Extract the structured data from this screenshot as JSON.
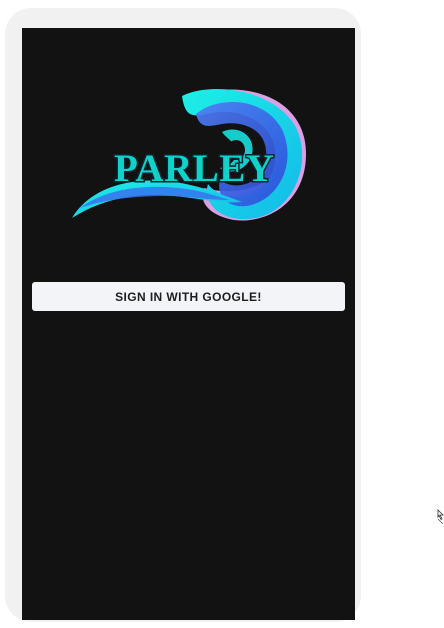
{
  "app": {
    "logo_text": "PARLEY",
    "logo_icon": "wave-logo-icon"
  },
  "auth": {
    "signin_label": "SIGN IN WITH GOOGLE!"
  },
  "colors": {
    "screen_background": "#121212",
    "frame": "#f1f1f2",
    "button_background": "#f3f4f8",
    "logo_cyan": "#18e0e0",
    "logo_blue": "#3a6df0",
    "logo_pink": "#e8a8f0"
  }
}
